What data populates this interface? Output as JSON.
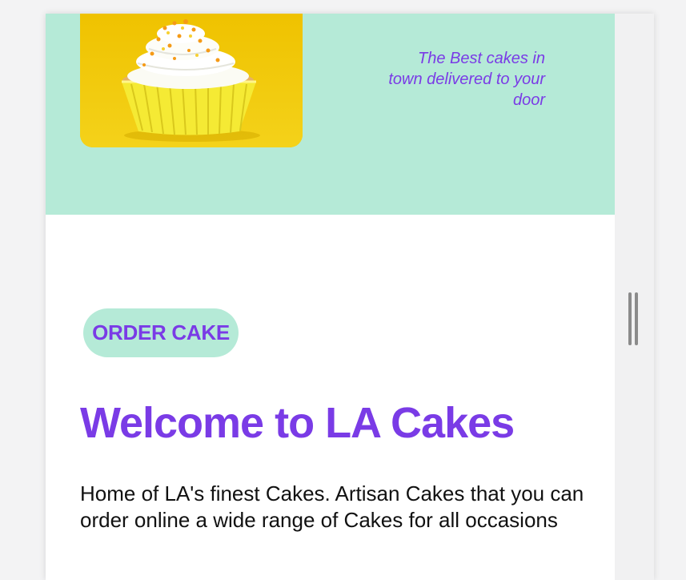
{
  "hero": {
    "image_name": "cupcake-photo",
    "tagline": "The Best cakes in town delivered to your door"
  },
  "main": {
    "order_button_label": "ORDER CAKE",
    "heading": "Welcome to LA Cakes",
    "intro_text": "Home of LA's finest Cakes. Artisan Cakes that you can order online a wide range of Cakes for all occasions"
  },
  "colors": {
    "accent_purple": "#7a3be6",
    "mint": "#b5ead7",
    "background": "#f3f3f4"
  }
}
